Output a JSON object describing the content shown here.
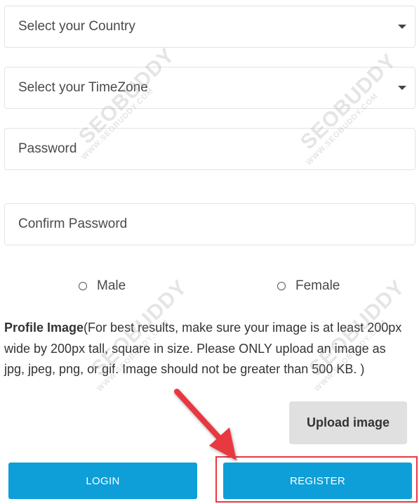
{
  "form": {
    "country_select": {
      "value": "Select your Country"
    },
    "timezone_select": {
      "value": "Select your TimeZone"
    },
    "password": {
      "placeholder": "Password"
    },
    "confirm_password": {
      "placeholder": "Confirm Password"
    },
    "gender": {
      "male_label": "Male",
      "female_label": "Female"
    },
    "profile_image": {
      "title": "Profile Image",
      "note": "(For best results, make sure your image is at least 200px wide by 200px tall, square in size. Please ONLY upload an image as jpg, jpeg, png, or gif. Image should not be greater than 500 KB. )"
    },
    "upload_button": "Upload image",
    "login_button": "LOGIN",
    "register_button": "REGISTER"
  },
  "watermark": {
    "brand": "SEOBUDDY",
    "url": "WWW.SEOBUDDY.COM"
  },
  "colors": {
    "primary_button": "#0e9fd8",
    "upload_button_bg": "#e0e0e0",
    "annotation_red": "#e8393f"
  },
  "icons": [
    "chevron-down-icon",
    "radio-icon",
    "arrow-annotation-icon"
  ]
}
